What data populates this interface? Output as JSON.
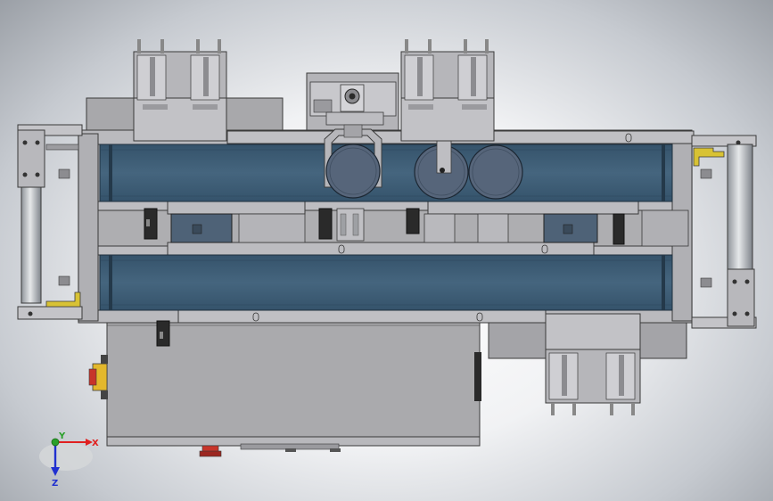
{
  "scene": {
    "colors": {
      "frame": "#a9a9ac",
      "frame_edge": "#3a3a3a",
      "belt": "#3d5c74",
      "belt_dark": "#2e4a60",
      "plate": "#b8b8bc",
      "plate_light": "#c6c6ca",
      "bracket_yellow": "#d8c234",
      "motor_blue": "#4e6277",
      "black_part": "#2a2a2a",
      "roller": "#56657a",
      "stop_red": "#c7342a",
      "stop_yellow": "#e3b82c"
    },
    "components": [
      "left-cylinder-assembly",
      "right-cylinder-assembly",
      "upper-conveyor-belt",
      "lower-conveyor-belt",
      "left-lifting-unit",
      "center-lifting-unit",
      "bottom-right-lifting-unit",
      "clamp-assembly",
      "roller-pair",
      "control-box",
      "emergency-stop"
    ]
  },
  "triad": {
    "x_label": "X",
    "y_label": "Y",
    "z_label": "Z",
    "x_color": "#e02020",
    "y_color": "#2aa02a",
    "z_color": "#2030d0"
  }
}
